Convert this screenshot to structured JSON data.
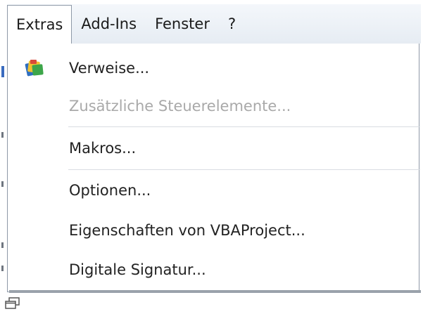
{
  "menubar": {
    "items": [
      {
        "label": "Extras",
        "active": true
      },
      {
        "label": "Add-Ins",
        "active": false
      },
      {
        "label": "Fenster",
        "active": false
      },
      {
        "label": "?",
        "active": false
      }
    ]
  },
  "menu": {
    "items": [
      {
        "label": "Verweise...",
        "enabled": true,
        "icon": "references-icon"
      },
      {
        "label": "Zusätzliche Steuerelemente...",
        "enabled": false
      },
      {
        "label": "Makros...",
        "enabled": true
      },
      {
        "label": "Optionen...",
        "enabled": true
      },
      {
        "label": "Eigenschaften von VBAProject...",
        "enabled": true
      },
      {
        "label": "Digitale Signatur...",
        "enabled": true
      }
    ]
  },
  "colors": {
    "menubar_background": "#e9eef5",
    "disabled_text": "#a9a9a9",
    "border": "#8e99a7"
  }
}
